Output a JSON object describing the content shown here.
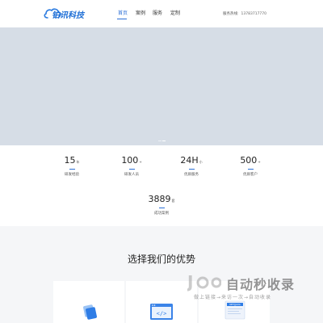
{
  "header": {
    "logo_text": "铂讯科技",
    "nav": [
      {
        "label": "首页",
        "active": true
      },
      {
        "label": "案例",
        "active": false
      },
      {
        "label": "服务",
        "active": false
      },
      {
        "label": "定制",
        "active": false
      }
    ],
    "hotline_label": "服务热线:",
    "hotline_number": "13783717770"
  },
  "banner": {
    "color": "#d6dde6"
  },
  "stats": [
    {
      "number": "15",
      "unit": "年",
      "label": "研发经验"
    },
    {
      "number": "100",
      "unit": "+",
      "label": "研发人员"
    },
    {
      "number": "24H",
      "unit": "小",
      "label": "优质服务"
    },
    {
      "number": "500",
      "unit": "+",
      "label": "优质客户"
    },
    {
      "number": "3889",
      "unit": "套",
      "label": "成功案例"
    }
  ],
  "advantages": {
    "title": "选择我们的优势",
    "cards": [
      {
        "icon": "puzzle-icon"
      },
      {
        "icon": "code-window-icon"
      },
      {
        "icon": "net-java-doc-icon",
        "badge": "NET|JAVA"
      }
    ]
  },
  "watermark": {
    "title": "自动秒收录",
    "subtitle": "做上链接→来访一次→自动收录"
  },
  "colors": {
    "accent": "#2b6fd6",
    "background": "#f5f6f8"
  }
}
